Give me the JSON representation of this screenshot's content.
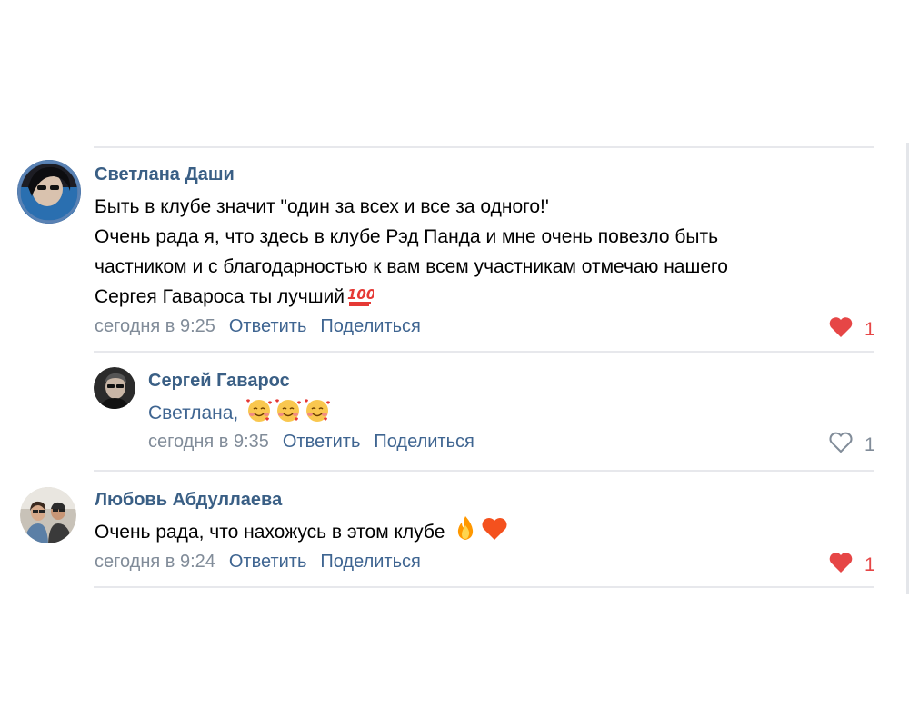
{
  "comments": [
    {
      "author": "Светлана Даши",
      "lines": [
        "Быть в клубе значит \"один за всех и все за одного!'",
        "Очень рада я, что здесь в клубе Рэд Панда и мне очень повезло быть",
        "частником и с благодарностью к вам всем участникам отмечаю нашего",
        "Сергея Гавароса ты лучший"
      ],
      "emoji_icon": "hundred-points-icon",
      "time": "сегодня в 9:25",
      "reply_label": "Ответить",
      "share_label": "Поделиться",
      "likes": "1",
      "liked": true
    },
    {
      "author": "Сергей Гаварос",
      "text": "Светлана,",
      "emoji_icons": [
        "smiling-face-with-hearts-icon",
        "smiling-face-with-hearts-icon",
        "smiling-face-with-hearts-icon"
      ],
      "time": "сегодня в 9:35",
      "reply_label": "Ответить",
      "share_label": "Поделиться",
      "likes": "1",
      "liked": false
    },
    {
      "author": "Любовь Абдуллаева",
      "text": "Очень рада, что нахожусь в этом клубе",
      "emoji_icons": [
        "fire-icon",
        "orange-heart-icon"
      ],
      "time": "сегодня в 9:24",
      "reply_label": "Ответить",
      "share_label": "Поделиться",
      "likes": "1",
      "liked": true
    }
  ],
  "colors": {
    "author": "#3a5f85",
    "link": "#3f6591",
    "meta": "#818c99",
    "like_active": "#e64646",
    "separator": "#e7e8ec"
  }
}
